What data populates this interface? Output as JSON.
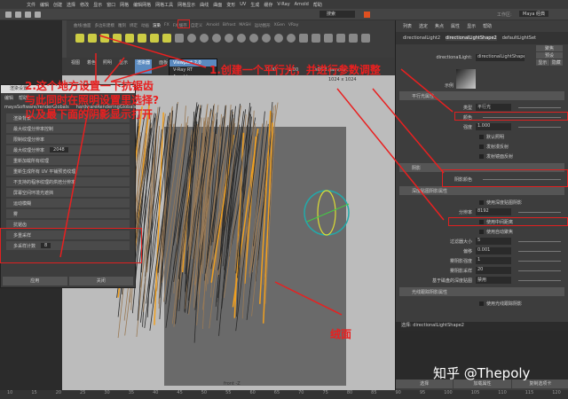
{
  "menubar": {
    "items": [
      "文件",
      "编辑",
      "创建",
      "选择",
      "修改",
      "显示",
      "窗口",
      "网格",
      "编辑网格",
      "网格工具",
      "网格显示",
      "曲线",
      "曲面",
      "变形",
      "UV",
      "生成",
      "缓存",
      "V-Ray",
      "Arnold",
      "帮助"
    ],
    "workspace_label": "工作区:",
    "workspace_value": "Maya 经典"
  },
  "toolbar": {
    "search_value": "搜索"
  },
  "shelf": {
    "tabs": [
      "曲线/曲面",
      "多边形建模",
      "雕刻",
      "绑定",
      "动画",
      "渲染",
      "FX",
      "FX 缓存",
      "自定义",
      "Arnold",
      "Bifrost",
      "MASH",
      "运动图形",
      "XGen",
      "VRay"
    ],
    "active_tab": "渲染"
  },
  "viewport": {
    "menu": [
      "视图",
      "着色",
      "照明",
      "显示",
      "渲染器",
      "面板"
    ],
    "renderer_menu": [
      "Viewport 2.0",
      "V-Ray RT",
      "Arnold"
    ],
    "gamma_value": "0.00",
    "exposure_value": "1.00",
    "colorspace": "sRGB gamma",
    "resolution": "1024 x 1024",
    "camera_label": "front -Z"
  },
  "render_settings": {
    "title": "渲染设置",
    "menu": [
      "编辑",
      "帮助"
    ],
    "tabs": [
      "mayaSoftware/renderGlobals",
      "hardwareRenderingGlobals"
    ],
    "rows": [
      "渲染背景",
      "最大纹理分辨率控制",
      "限制纹理分辨率",
      "最大纹理分辨率",
      "重新加载所有纹理",
      "重新生成所有 UV 平铺预览纹理",
      "不支持的程序纹理的烘焙分辨率",
      "屏幕空间环境光遮挡",
      "运动模糊",
      "雾",
      "抗锯齿",
      "多重采样",
      "多采样计数"
    ],
    "max_tex_res": "2048",
    "sample_count": "8",
    "buttons": [
      "应用",
      "关闭"
    ]
  },
  "attribute_editor": {
    "menu": [
      "列表",
      "选定",
      "焦点",
      "属性",
      "显示",
      "帮助"
    ],
    "tabs": [
      "directionalLight2",
      "directionalLightShape2",
      "defaultLightSet"
    ],
    "node_label": "directionalLight:",
    "node_value": "directionalLightShape2",
    "buttons": [
      "聚焦",
      "预设",
      "显示",
      "隐藏"
    ],
    "sample_label": "示例",
    "sections": [
      "平行光属性",
      "阴影",
      "深度贴图阴影属性",
      "光线跟踪阴影属性"
    ],
    "rows": {
      "type_label": "类型",
      "type_value": "平行光",
      "color_label": "颜色",
      "intensity_label": "强度",
      "intensity_value": "1.000",
      "illum_default": "默认照明",
      "emit_diffuse": "发射漫反射",
      "emit_specular": "发射镜面反射",
      "shadow_color": "阴影颜色",
      "use_depth_map": "使用深度贴图阴影",
      "resolution_label": "分辨率",
      "resolution_value": "8192",
      "use_mid_dist": "使用中间距离",
      "use_auto_focus": "使用自动聚焦",
      "filter_size_label": "过滤器大小",
      "filter_size_value": "5",
      "bias_label": "偏移",
      "bias_value": "0.001",
      "fog_intensity_label": "雾阴影强度",
      "fog_intensity_value": "1",
      "fog_samples_label": "雾阴影采样",
      "fog_samples_value": "20",
      "disk_label": "基于磁盘的深度贴图",
      "disk_value": "禁用",
      "raytrace_label": "使用光线跟踪阴影"
    },
    "status": "选择: directionalLightShape2",
    "bottom_buttons": [
      "选择",
      "加载属性",
      "复制选项卡"
    ]
  },
  "annotations": {
    "step1": "1.创建一个平行光，并进行参数调整",
    "step2_l1": "2.这个地方设置一下抗锯齿",
    "step2_l2": "与此同时在照明设置里选择?",
    "step2_l3": "以及最下面的阴影显示打开",
    "hair_label": "绒面"
  },
  "timeline": {
    "ticks": [
      "10",
      "15",
      "20",
      "25",
      "30",
      "35",
      "40",
      "45",
      "50",
      "55",
      "60",
      "65",
      "70",
      "75",
      "80",
      "85",
      "90",
      "95",
      "100",
      "105",
      "110",
      "115",
      "120"
    ]
  },
  "watermark": "知乎 @Thepoly",
  "colors": {
    "annotation": "#e82020",
    "hair": "#9a7a55",
    "hair_highlight": "#f0a020"
  }
}
